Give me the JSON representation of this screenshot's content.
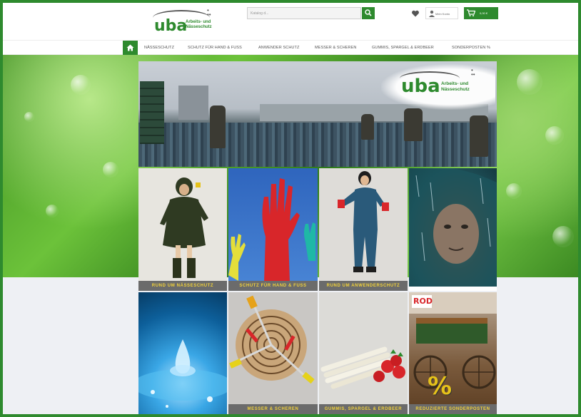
{
  "header": {
    "logo": {
      "name": "uba",
      "subtitle_line1": "Arbeits- und",
      "subtitle_line2": "Nässeschutz"
    },
    "search": {
      "placeholder": "Katalog d..."
    },
    "account": {
      "label": "Mein Konto"
    },
    "cart": {
      "label": "0,00 €"
    },
    "colors": {
      "accent": "#2e8a2e"
    }
  },
  "nav": {
    "home_icon": "home-icon",
    "items": [
      {
        "label": "NÄSSESCHUTZ"
      },
      {
        "label": "SCHUTZ FÜR HAND & FUSS"
      },
      {
        "label": "ANWENDER SCHUTZ"
      },
      {
        "label": "MESSER & SCHEREN"
      },
      {
        "label": "GUMMIS, SPARGEL & ERDBEER"
      },
      {
        "label": "SONDERPOSTEN %"
      }
    ]
  },
  "hero": {
    "logo_name": "uba",
    "logo_sub1": "Arbeits- und",
    "logo_sub2": "Nässeschutz"
  },
  "tiles": [
    {
      "label": "RUND UM NÄSSESCHUTZ"
    },
    {
      "label": "SCHUTZ FÜR HAND & FUSS"
    },
    {
      "label": "RUND UM ANWENDERSCHUTZ"
    },
    {
      "label": ""
    },
    {
      "label": ""
    },
    {
      "label": "MESSER & SCHEREN"
    },
    {
      "label": "GUMMIS, SPARGEL & ERDBEER"
    },
    {
      "label": "REDUZIERTE SONDERPOSTEN"
    }
  ],
  "tile8_sign": "ROD",
  "tile8_percent": "%"
}
